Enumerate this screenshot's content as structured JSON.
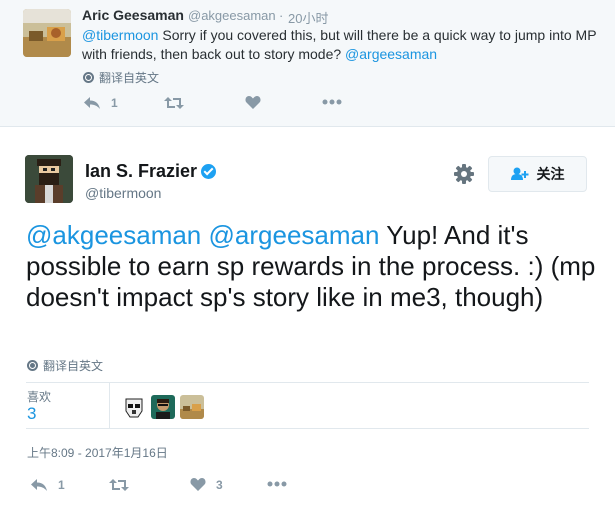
{
  "parent_tweet": {
    "name": "Aric Geesaman",
    "handle": "@akgeesaman",
    "separator": "·",
    "time": "20小时",
    "mention": "@tibermoon",
    "text": " Sorry if you covered this, but will there be a quick way to jump into MP with friends, then back out to story mode? ",
    "mention_end": "@argeesaman",
    "translate_label": "翻译自英文",
    "reply_count": "1"
  },
  "main_tweet": {
    "name": "Ian S. Frazier",
    "handle": "@tibermoon",
    "follow_label": "关注",
    "mention1": "@akgeesaman",
    "mention2": "@argeesaman",
    "text": " Yup! And it's possible to earn sp rewards in the process. :) (mp doesn't impact sp's story like in me3, though)",
    "translate_label": "翻译自英文",
    "likes_label": "喜欢",
    "likes_count": "3",
    "timestamp": "上午8:09 - 2017年1月16日",
    "reply_count": "1",
    "like_count": "3"
  },
  "colors": {
    "link": "#1b95e0",
    "verified": "#1da1f2",
    "muted": "#8899a6"
  }
}
